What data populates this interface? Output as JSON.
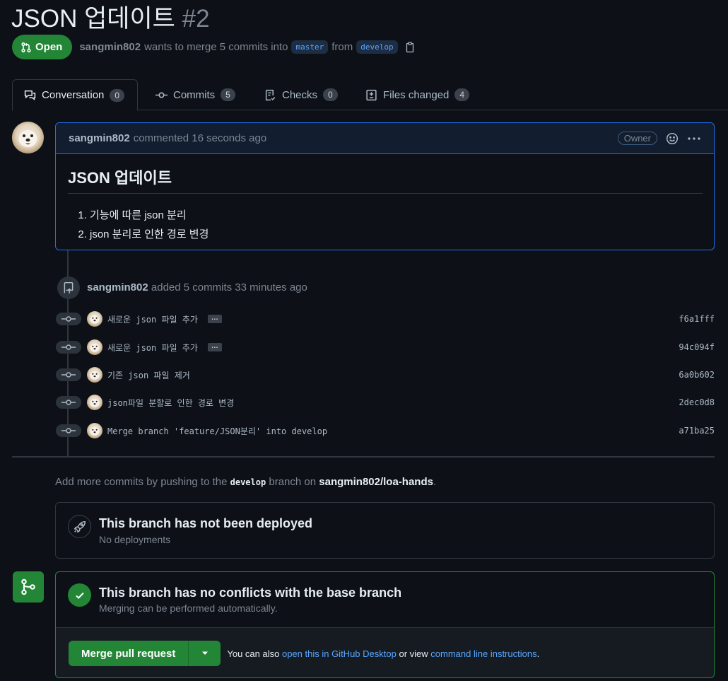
{
  "pr": {
    "title": "JSON 업데이트",
    "number": "#2",
    "state": "Open",
    "author": "sangmin802",
    "meta_text": "wants to merge 5 commits into",
    "base_branch": "master",
    "from_text": "from",
    "head_branch": "develop"
  },
  "tabs": [
    {
      "label": "Conversation",
      "count": "0"
    },
    {
      "label": "Commits",
      "count": "5"
    },
    {
      "label": "Checks",
      "count": "0"
    },
    {
      "label": "Files changed",
      "count": "4"
    }
  ],
  "comment": {
    "author": "sangmin802",
    "time": "commented 16 seconds ago",
    "role": "Owner",
    "heading": "JSON 업데이트",
    "items": [
      "기능에 따른 json 분리",
      "json 분리로 인한 경로 변경"
    ]
  },
  "event": {
    "author": "sangmin802",
    "text": "added 5 commits 33 minutes ago"
  },
  "commits": [
    {
      "message": "새로운 json 파일 추가",
      "sha": "f6a1fff",
      "ellipsis": "…"
    },
    {
      "message": "새로운 json 파일 추가",
      "sha": "94c094f",
      "ellipsis": "…"
    },
    {
      "message": "기존 json 파일 제거",
      "sha": "6a0b602"
    },
    {
      "message": "json파일 분할로 인한 경로 변경",
      "sha": "2dec0d8"
    },
    {
      "message": "Merge branch 'feature/JSON분리' into develop",
      "sha": "a71ba25"
    }
  ],
  "hint": {
    "prefix": "Add more commits by pushing to the",
    "branch": "develop",
    "middle": "branch on",
    "repo": "sangmin802/loa-hands",
    "suffix": "."
  },
  "deploy": {
    "title": "This branch has not been deployed",
    "subtitle": "No deployments"
  },
  "merge": {
    "title": "This branch has no conflicts with the base branch",
    "subtitle": "Merging can be performed automatically.",
    "button": "Merge pull request",
    "note_prefix": "You can also",
    "link_desktop": "open this in GitHub Desktop",
    "note_middle": "or view",
    "link_cli": "command line instructions",
    "note_suffix": "."
  },
  "colors": {
    "background": "#0d1117",
    "open_green": "#238636",
    "link_blue": "#58a6ff",
    "comment_border": "#1f6feb"
  }
}
